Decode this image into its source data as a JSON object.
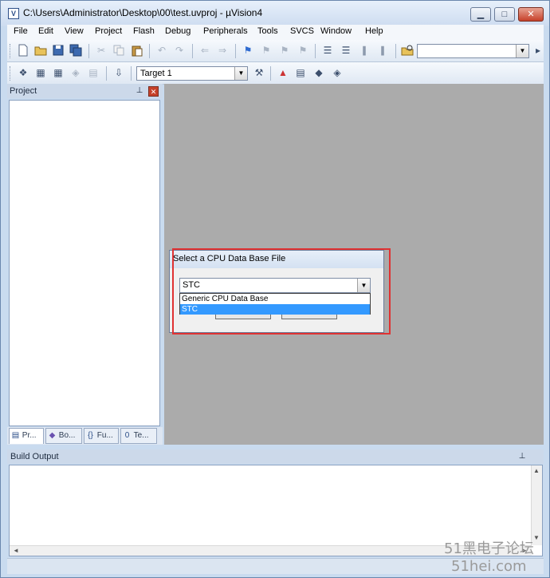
{
  "window": {
    "title": "C:\\Users\\Administrator\\Desktop\\00\\test.uvproj - µVision4",
    "icon_letter": "V",
    "minimize": "▁",
    "maximize": "□",
    "close": "✕"
  },
  "menu": [
    "File",
    "Edit",
    "View",
    "Project",
    "Flash",
    "Debug",
    "Peripherals",
    "Tools",
    "SVCS",
    "Window",
    "Help"
  ],
  "toolbar2": {
    "target": "Target 1"
  },
  "project_panel": {
    "title": "Project",
    "pin": "⊥",
    "close": "✕",
    "tabs": [
      "Pr...",
      "Bo...",
      "Fu...",
      "Te..."
    ],
    "tab_icons": [
      "▤",
      "◆",
      "{}",
      "0"
    ]
  },
  "dialog": {
    "title": "Select a CPU Data Base File",
    "selected": "STC",
    "options": [
      "Generic CPU Data Base",
      "STC"
    ]
  },
  "build_output": {
    "title": "Build Output",
    "pin": "⊥",
    "scroll_up": "▲",
    "scroll_down": "▼",
    "scroll_left": "◄",
    "scroll_right": "►"
  },
  "watermark": {
    "line1": "51黑电子论坛",
    "line2": "51hei.com"
  }
}
